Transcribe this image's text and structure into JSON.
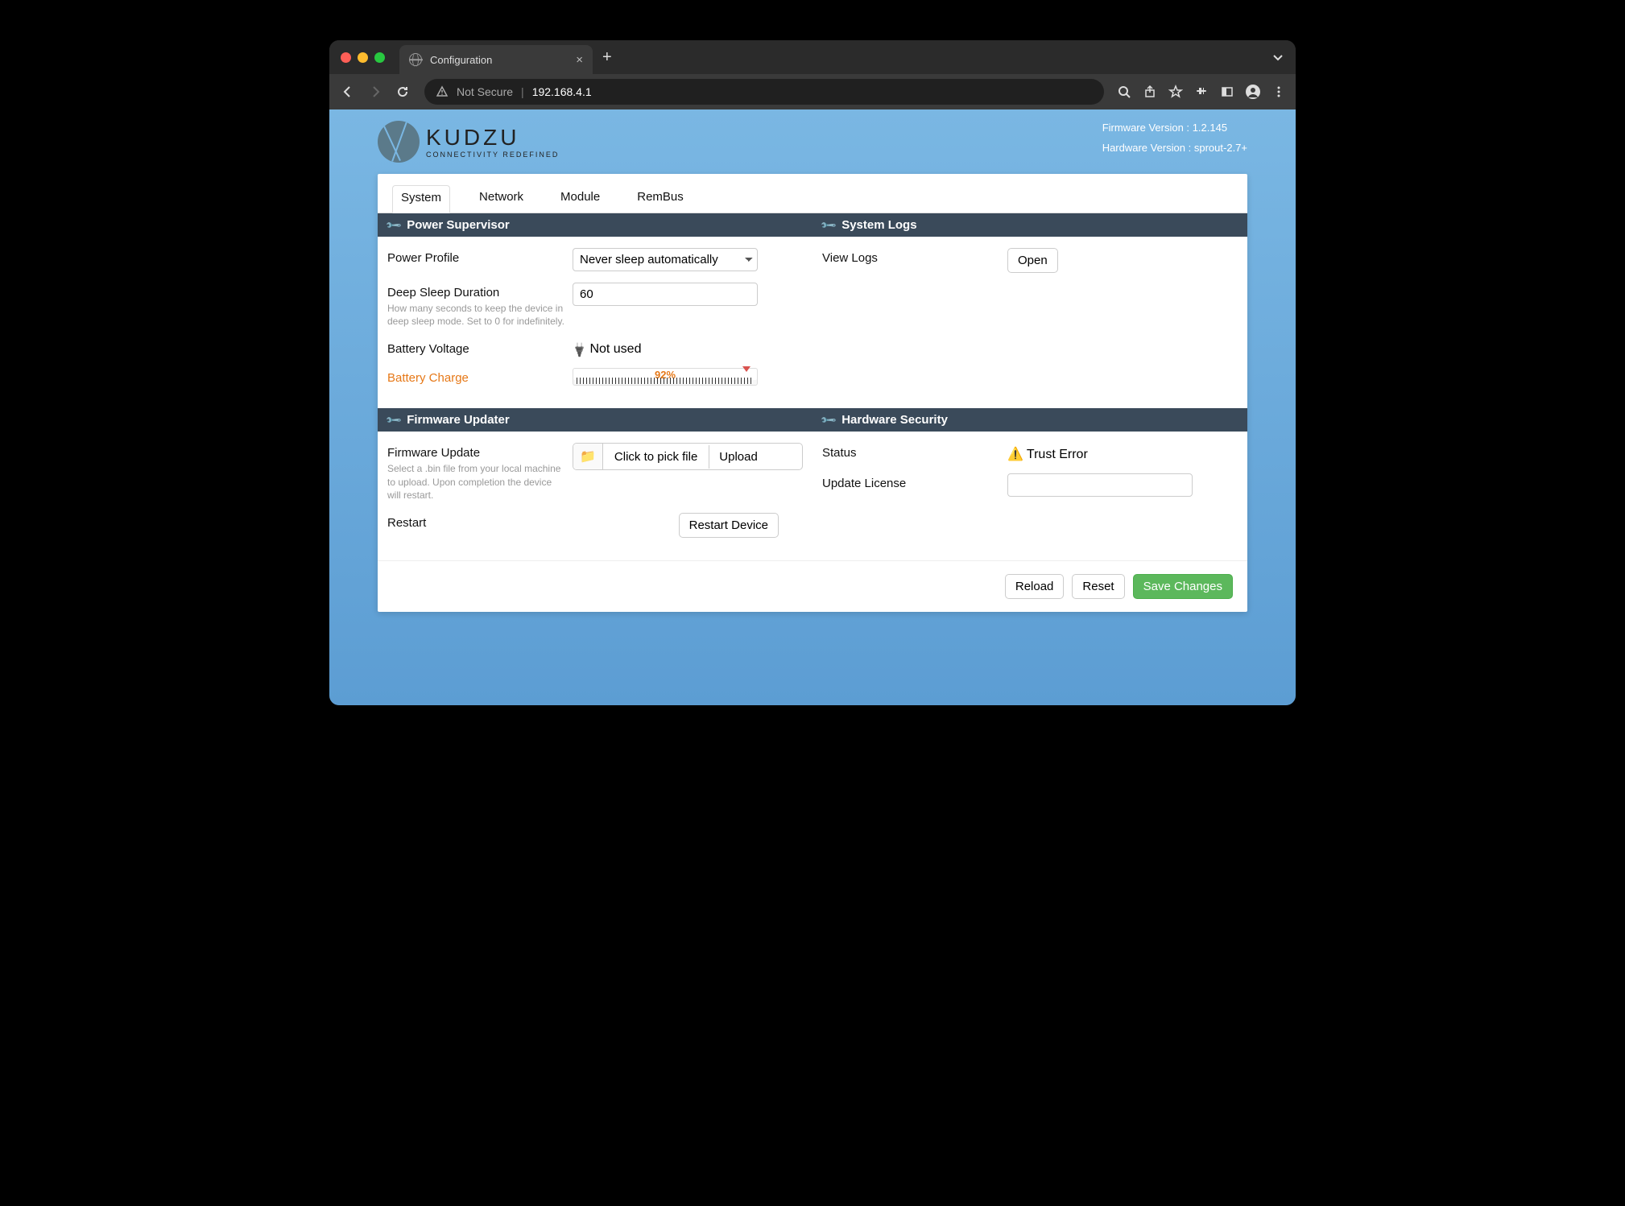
{
  "browser": {
    "tab_title": "Configuration",
    "address_not_secure": "Not Secure",
    "address_ip": "192.168.4.1"
  },
  "header": {
    "brand": "KUDZU",
    "tagline": "CONNECTIVITY REDEFINED",
    "fw_label": "Firmware Version :",
    "fw_value": "1.2.145",
    "hw_label": "Hardware Version :",
    "hw_value": "sprout-2.7+"
  },
  "tabs": {
    "system": "System",
    "network": "Network",
    "module": "Module",
    "rembus": "RemBus"
  },
  "power": {
    "title": "Power Supervisor",
    "profile_label": "Power Profile",
    "profile_value": "Never sleep automatically",
    "sleep_label": "Deep Sleep Duration",
    "sleep_value": "60",
    "sleep_help": "How many seconds to keep the device in deep sleep mode. Set to 0 for indefinitely.",
    "batv_label": "Battery Voltage",
    "batv_value": "Not used",
    "batc_label": "Battery Charge",
    "batc_value": "92%",
    "batc_pct": 92
  },
  "syslogs": {
    "title": "System Logs",
    "view_label": "View Logs",
    "open": "Open"
  },
  "fw": {
    "title": "Firmware Updater",
    "update_label": "Firmware Update",
    "update_help": "Select a .bin file from your local machine to upload. Upon completion the device will restart.",
    "pick": "Click to pick file",
    "upload": "Upload",
    "restart_label": "Restart",
    "restart_btn": "Restart Device"
  },
  "hw": {
    "title": "Hardware Security",
    "status_label": "Status",
    "status_value": "Trust Error",
    "license_label": "Update License"
  },
  "footer": {
    "reload": "Reload",
    "reset": "Reset",
    "save": "Save Changes"
  }
}
